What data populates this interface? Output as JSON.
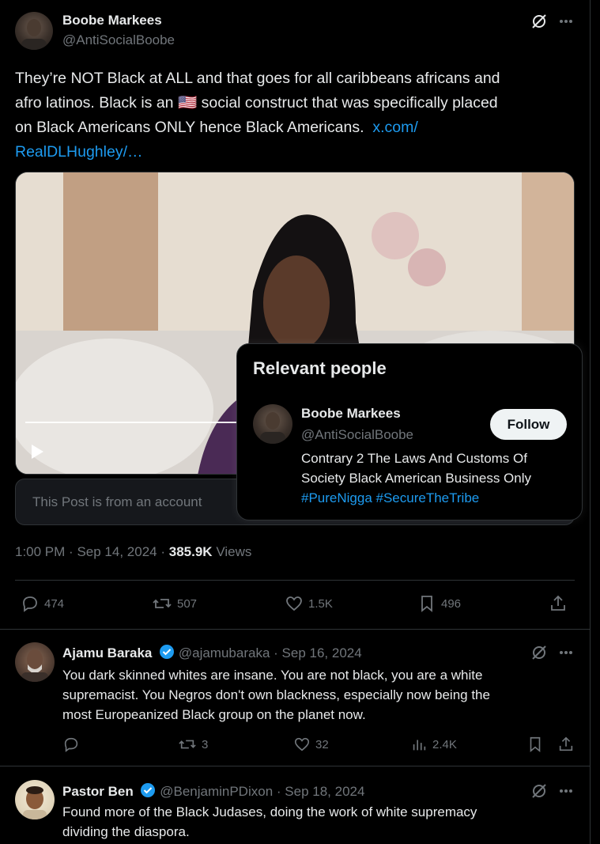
{
  "main_post": {
    "author_name": "Boobe Markees",
    "handle": "@AntiSocialBoobe",
    "text_parts": {
      "line1": "They’re NOT Black at ALL and that goes for all caribbeans africans and",
      "line2a": "afro latinos. Black is an ",
      "line2b": " social construct that was specifically placed",
      "line3": "on Black Americans ONLY hence Black Americans.",
      "link1": "x.com/",
      "link2": "RealDLHughley/…"
    },
    "flag_emoji": "🇺🇸",
    "notice_text": "This Post is from an account",
    "time": "1:00 PM",
    "date": "Sep 14, 2024",
    "views_count": "385.9K",
    "views_label": "Views",
    "separator": "·",
    "stats": {
      "replies": "474",
      "reposts": "507",
      "likes": "1.5K",
      "bookmarks": "496"
    }
  },
  "relevant_people": {
    "title": "Relevant people",
    "name": "Boobe Markees",
    "handle": "@AntiSocialBoobe",
    "follow_label": "Follow",
    "bio_line1": "Contrary 2 The Laws And Customs Of",
    "bio_line2": "Society Black American Business Only",
    "hashtag1": "#PureNigga",
    "hashtag2": "#SecureTheTribe"
  },
  "replies": [
    {
      "name": "Ajamu Baraka",
      "handle": "@ajamubaraka",
      "date": "Sep 16, 2024",
      "line1": "You dark skinned whites are insane. You are not black, you are a white",
      "line2": "supremacist. You Negros don't own blackness, especially now being the",
      "line3": "most Europeanized Black group on the planet now.",
      "reposts": "3",
      "likes": "32",
      "views": "2.4K"
    },
    {
      "name": "Pastor Ben",
      "handle": "@BenjaminPDixon",
      "date": "Sep 18, 2024",
      "line1": "Found more of the Black Judases, doing the work of white supremacy",
      "line2": "dividing the diaspora."
    }
  ],
  "colors": {
    "background": "#000000",
    "text": "#e7e9ea",
    "muted": "#71767b",
    "link": "#1d9bf0",
    "border": "#2f3336",
    "verified": "#1d9bf0"
  }
}
